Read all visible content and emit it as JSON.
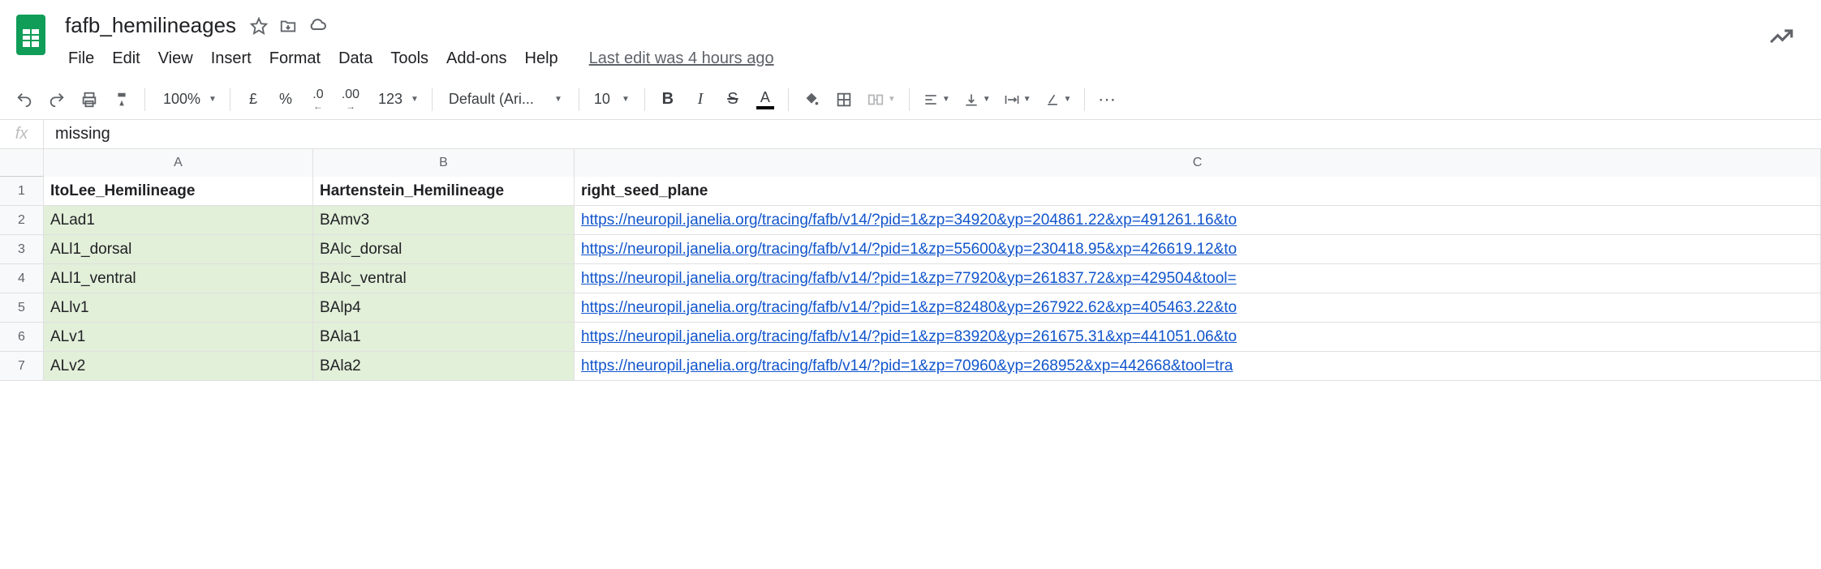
{
  "doc": {
    "title": "fafb_hemilineages",
    "last_edit": "Last edit was 4 hours ago"
  },
  "menu": {
    "file": "File",
    "edit": "Edit",
    "view": "View",
    "insert": "Insert",
    "format": "Format",
    "data": "Data",
    "tools": "Tools",
    "addons": "Add-ons",
    "help": "Help"
  },
  "toolbar": {
    "zoom": "100%",
    "currency": "£",
    "percent": "%",
    "dec_decrease": ".0",
    "dec_increase": ".00",
    "numfmt": "123",
    "font": "Default (Ari...",
    "fontsize": "10",
    "more": "⋯"
  },
  "formula": {
    "fx": "fx",
    "value": "missing"
  },
  "columns": {
    "A": "A",
    "B": "B",
    "C": "C"
  },
  "headers": {
    "A": "ItoLee_Hemilineage",
    "B": "Hartenstein_Hemilineage",
    "C": "right_seed_plane"
  },
  "rows": [
    {
      "n": "1"
    },
    {
      "n": "2",
      "A": "ALad1",
      "B": "BAmv3",
      "C": "https://neuropil.janelia.org/tracing/fafb/v14/?pid=1&zp=34920&yp=204861.22&xp=491261.16&to"
    },
    {
      "n": "3",
      "A": "ALl1_dorsal",
      "B": "BAlc_dorsal",
      "C": "https://neuropil.janelia.org/tracing/fafb/v14/?pid=1&zp=55600&yp=230418.95&xp=426619.12&to"
    },
    {
      "n": "4",
      "A": "ALl1_ventral",
      "B": "BAlc_ventral",
      "C": "https://neuropil.janelia.org/tracing/fafb/v14/?pid=1&zp=77920&yp=261837.72&xp=429504&tool="
    },
    {
      "n": "5",
      "A": "ALlv1",
      "B": "BAlp4",
      "C": "https://neuropil.janelia.org/tracing/fafb/v14/?pid=1&zp=82480&yp=267922.62&xp=405463.22&to"
    },
    {
      "n": "6",
      "A": "ALv1",
      "B": "BAla1",
      "C": "https://neuropil.janelia.org/tracing/fafb/v14/?pid=1&zp=83920&yp=261675.31&xp=441051.06&to"
    },
    {
      "n": "7",
      "A": "ALv2",
      "B": "BAla2",
      "C": "https://neuropil.janelia.org/tracing/fafb/v14/?pid=1&zp=70960&yp=268952&xp=442668&tool=tra"
    }
  ]
}
